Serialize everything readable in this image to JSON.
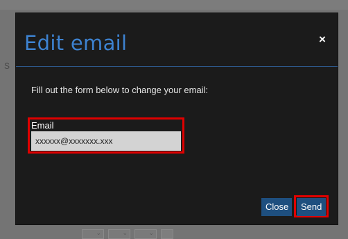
{
  "background": {
    "letter": "S"
  },
  "modal": {
    "title": "Edit email",
    "close_icon": "×",
    "instructions": "Fill out the form below to change your email:",
    "email": {
      "label": "Email",
      "value": "xxxxxx@xxxxxxx.xxx"
    },
    "buttons": {
      "close_label": "Close",
      "send_label": "Send"
    },
    "colors": {
      "title": "#3d82d0",
      "button_bg": "#1e4f7f",
      "highlight": "#e00000"
    }
  }
}
